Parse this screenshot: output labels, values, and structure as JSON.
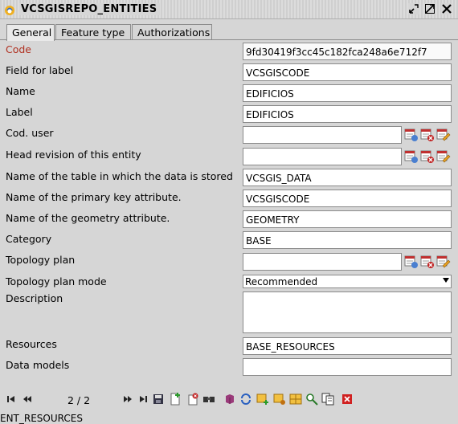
{
  "window": {
    "title": "VCSGISREPO_ENTITIES"
  },
  "tabs": [
    {
      "label": "General",
      "active": true
    },
    {
      "label": "Feature type",
      "active": false
    },
    {
      "label": "Authorizations",
      "active": false
    }
  ],
  "form": {
    "code": {
      "label": "Code",
      "value": "9fd30419f3cc45c182fca248a6e712f7"
    },
    "field_for_label": {
      "label": "Field for label",
      "value": "VCSGISCODE"
    },
    "name": {
      "label": "Name",
      "value": "EDIFICIOS"
    },
    "label": {
      "label": "Label",
      "value": "EDIFICIOS"
    },
    "cod_user": {
      "label": "Cod. user",
      "value": ""
    },
    "head_revision": {
      "label": "Head revision of this entity",
      "value": ""
    },
    "table_name": {
      "label": "Name of the table in which the data is stored",
      "value": "VCSGIS_DATA"
    },
    "pk_attribute": {
      "label": "Name of the primary key attribute.",
      "value": "VCSGISCODE"
    },
    "geometry_attribute": {
      "label": "Name of the geometry attribute.",
      "value": "GEOMETRY"
    },
    "category": {
      "label": "Category",
      "value": "BASE"
    },
    "topology_plan": {
      "label": "Topology plan",
      "value": ""
    },
    "topology_plan_mode": {
      "label": "Topology plan mode",
      "value": "Recommended"
    },
    "description": {
      "label": "Description",
      "value": ""
    },
    "resources": {
      "label": "Resources",
      "value": "BASE_RESOURCES"
    },
    "data_models": {
      "label": "Data models",
      "value": ""
    }
  },
  "navigation": {
    "position": "2 / 2"
  },
  "status_bar": {
    "text": "ENT_RESOURCES"
  },
  "colors": {
    "required_label": "#b03020",
    "background": "#d6d6d6"
  },
  "icons": {
    "relation_buttons": [
      "table-view-icon",
      "table-clear-icon",
      "table-edit-icon"
    ],
    "toolbar": [
      "first-record-icon",
      "previous-record-icon",
      "next-record-icon",
      "last-record-icon",
      "save-icon",
      "new-record-icon",
      "delete-record-icon",
      "search-icon",
      "database-icon",
      "refresh-icon",
      "add-filter-icon",
      "filter-icon",
      "filter-options-icon",
      "zoom-icon",
      "copy-icon",
      "close-icon"
    ]
  }
}
